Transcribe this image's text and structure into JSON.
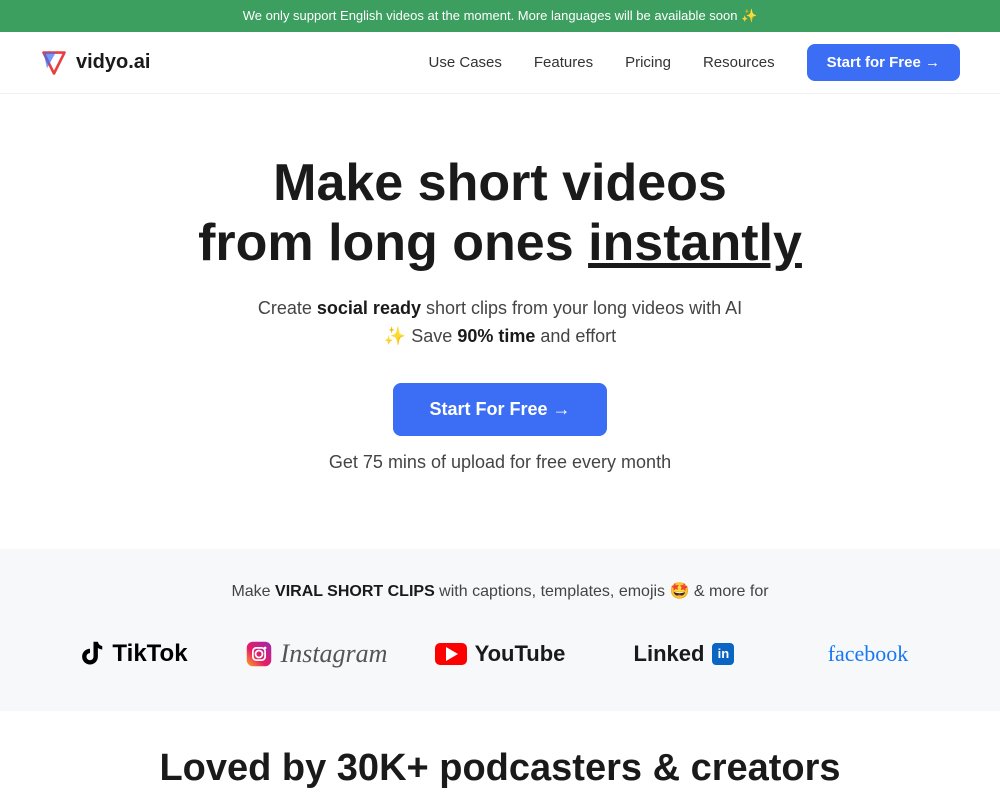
{
  "banner": {
    "text": "We only support English videos at the moment. More languages will be available soon ✨"
  },
  "nav": {
    "logo_text": "vidyo.ai",
    "links": [
      {
        "label": "Use Cases",
        "id": "use-cases"
      },
      {
        "label": "Features",
        "id": "features"
      },
      {
        "label": "Pricing",
        "id": "pricing"
      },
      {
        "label": "Resources",
        "id": "resources"
      }
    ],
    "cta_label": "Start for Free →"
  },
  "hero": {
    "headline_line1": "Make short videos",
    "headline_line2": "from long ones ",
    "headline_emphasis": "instantly",
    "subtext_part1": "Create ",
    "subtext_bold1": "social ready",
    "subtext_part2": " short clips from your long videos with AI ✨ Save ",
    "subtext_bold2": "90% time",
    "subtext_part3": " and effort",
    "cta_label": "Start For Free →",
    "sub_note": "Get 75 mins of upload for free every month"
  },
  "platforms": {
    "tagline_part1": "Make ",
    "tagline_bold": "VIRAL short clips",
    "tagline_part2": " with captions, templates, emojis 🤩 & more for",
    "items": [
      {
        "id": "tiktok",
        "name": "TikTok"
      },
      {
        "id": "instagram",
        "name": "Instagram"
      },
      {
        "id": "youtube",
        "name": "YouTube"
      },
      {
        "id": "linkedin",
        "name": "Linked"
      },
      {
        "id": "facebook",
        "name": "facebook"
      }
    ]
  },
  "loved": {
    "heading": "Loved by 30K+ podcasters & creators"
  }
}
